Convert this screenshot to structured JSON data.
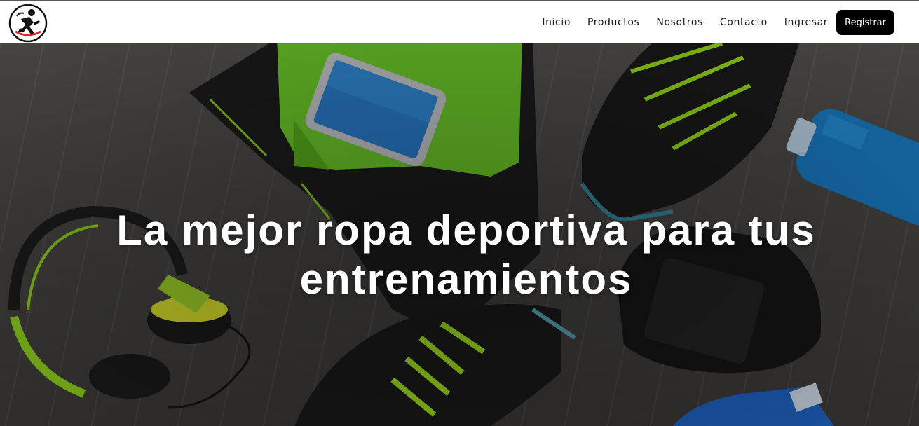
{
  "header": {
    "logo_icon": "runner-logo-icon",
    "nav": {
      "inicio": "Inicio",
      "productos": "Productos",
      "nosotros": "Nosotros",
      "contacto": "Contacto",
      "ingresar": "Ingresar"
    },
    "register_label": "Registrar"
  },
  "hero": {
    "title": "La mejor ropa deportiva para tus entrenamientos",
    "background_image": "sports-gear-flatlay-image"
  },
  "colors": {
    "navbar_bg": "#ffffff",
    "button_bg": "#000000",
    "hero_text": "#ffffff",
    "accent_green": "#8fd21c"
  }
}
